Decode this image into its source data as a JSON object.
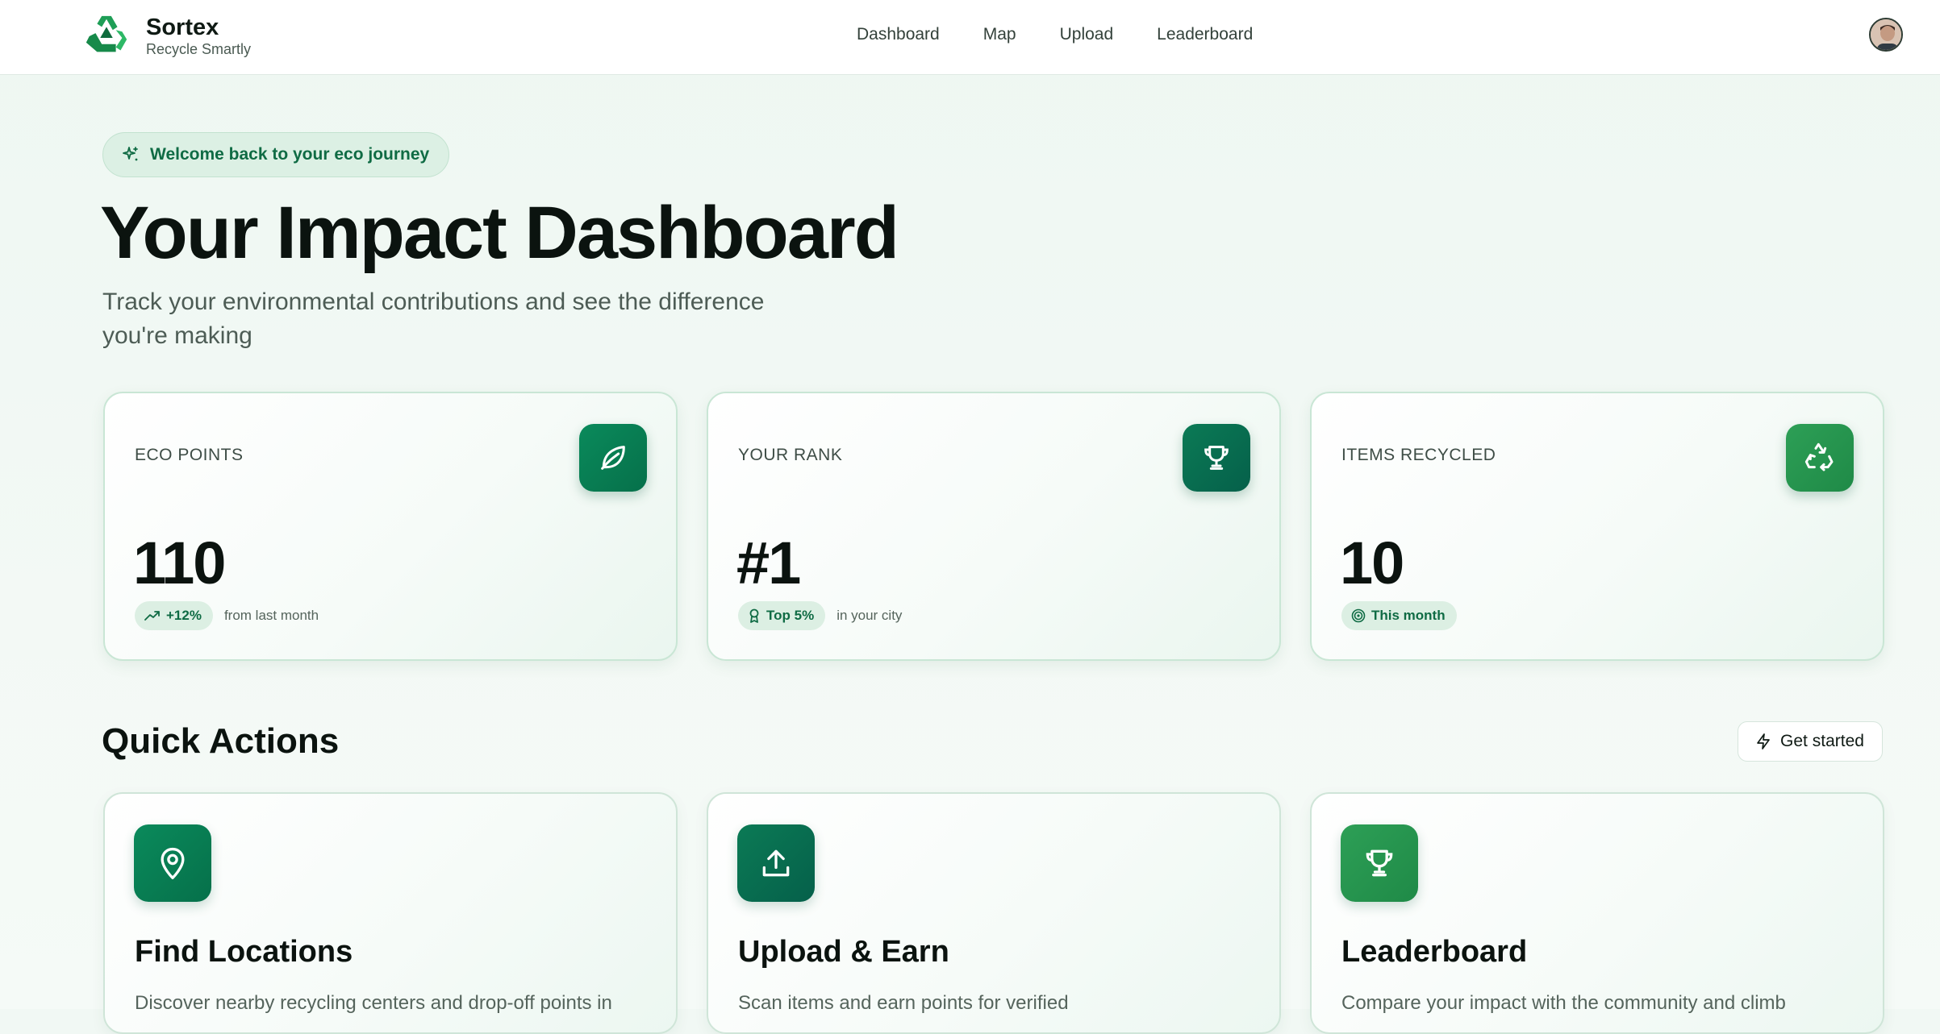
{
  "brand": {
    "name": "Sortex",
    "tagline": "Recycle Smartly"
  },
  "nav": {
    "items": [
      "Dashboard",
      "Map",
      "Upload",
      "Leaderboard"
    ]
  },
  "hero": {
    "pill": "Welcome back to your eco journey",
    "title": "Your Impact Dashboard",
    "subtitle_line1": "Track your environmental contributions and see the difference",
    "subtitle_line2": "you're making"
  },
  "stats": [
    {
      "label": "ECO POINTS",
      "value": "110",
      "badge": "+12%",
      "note": "from last month",
      "icon": "leaf-icon"
    },
    {
      "label": "YOUR RANK",
      "value": "#1",
      "badge": "Top 5%",
      "note": "in your city",
      "icon": "trophy-icon"
    },
    {
      "label": "ITEMS RECYCLED",
      "value": "10",
      "badge": "This month",
      "note": "",
      "icon": "recycle-icon"
    }
  ],
  "quick_actions": {
    "title": "Quick Actions",
    "get_started": "Get started",
    "cards": [
      {
        "title": "Find Locations",
        "desc": "Discover nearby recycling centers and drop-off points in",
        "icon": "map-pin-icon"
      },
      {
        "title": "Upload & Earn",
        "desc": "Scan items and earn points for verified",
        "icon": "upload-icon"
      },
      {
        "title": "Leaderboard",
        "desc": "Compare your impact with the community and climb",
        "icon": "trophy-icon"
      }
    ]
  },
  "colors": {
    "primary": "#0a8a5b",
    "primary_dark": "#05604a",
    "accent_light": "#dcf0e4",
    "text": "#0b130f"
  }
}
